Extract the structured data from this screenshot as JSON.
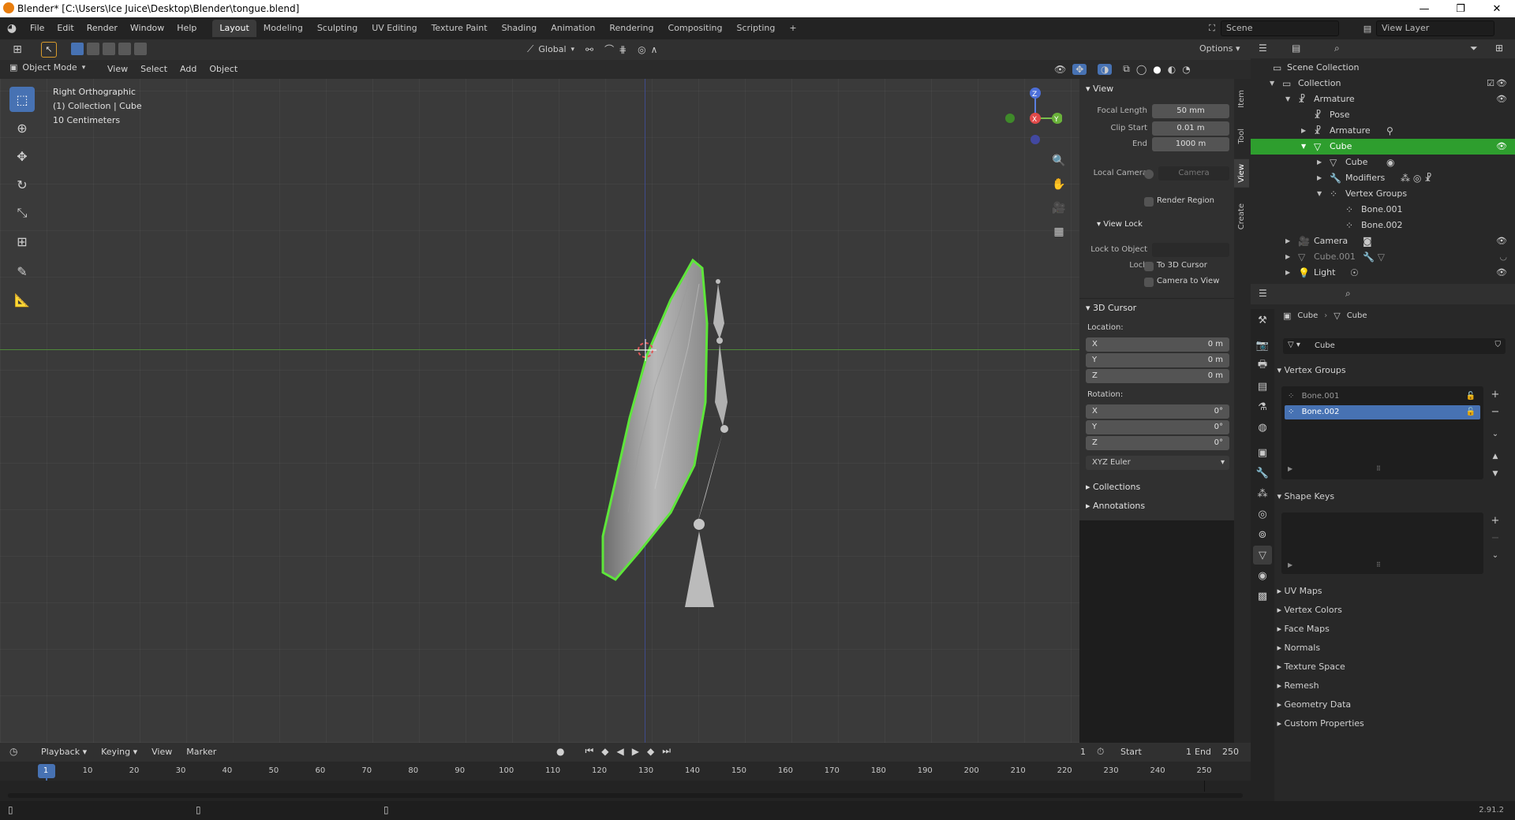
{
  "window": {
    "title": "Blender* [C:\\Users\\Ice Juice\\Desktop\\Blender\\tongue.blend]",
    "minimize": "—",
    "maximize": "❐",
    "close": "✕"
  },
  "menubar": {
    "items": [
      "File",
      "Edit",
      "Render",
      "Window",
      "Help"
    ],
    "workspaces": [
      "Layout",
      "Modeling",
      "Sculpting",
      "UV Editing",
      "Texture Paint",
      "Shading",
      "Animation",
      "Rendering",
      "Compositing",
      "Scripting"
    ],
    "active_workspace": "Layout",
    "add_tab": "+",
    "scene": "Scene",
    "view_layer": "View Layer"
  },
  "viewport_header": {
    "transform_orientation": "Global",
    "options": "Options",
    "mode": "Object Mode",
    "menus": [
      "View",
      "Select",
      "Add",
      "Object"
    ]
  },
  "viewport": {
    "view_name": "Right Orthographic",
    "collection_info": "(1) Collection | Cube",
    "scale": "10 Centimeters",
    "gizmo": {
      "z": "Z",
      "x": "X",
      "y": "Y"
    }
  },
  "npanel": {
    "tabs": [
      "Item",
      "Tool",
      "View",
      "Create"
    ],
    "view": {
      "title": "View",
      "focal_length_label": "Focal Length",
      "focal_length": "50 mm",
      "clip_start_label": "Clip Start",
      "clip_start": "0.01 m",
      "end_label": "End",
      "end": "1000 m",
      "local_camera_label": "Local Camera",
      "local_camera_placeholder": "Camera",
      "render_region": "Render Region"
    },
    "view_lock": {
      "title": "View Lock",
      "lock_to_object_label": "Lock to Object",
      "lock_label": "Lock",
      "to_3d_cursor": "To 3D Cursor",
      "camera_to_view": "Camera to View"
    },
    "cursor": {
      "title": "3D Cursor",
      "location_label": "Location:",
      "loc_x_label": "X",
      "loc_x": "0 m",
      "loc_y_label": "Y",
      "loc_y": "0 m",
      "loc_z_label": "Z",
      "loc_z": "0 m",
      "rotation_label": "Rotation:",
      "rot_x_label": "X",
      "rot_x": "0°",
      "rot_y_label": "Y",
      "rot_y": "0°",
      "rot_z_label": "Z",
      "rot_z": "0°",
      "rotation_mode": "XYZ Euler"
    },
    "collections": "Collections",
    "annotations": "Annotations"
  },
  "outliner": {
    "rows": [
      {
        "label": "Scene Collection",
        "indent": 0
      },
      {
        "label": "Collection",
        "indent": 1
      },
      {
        "label": "Armature",
        "indent": 2
      },
      {
        "label": "Pose",
        "indent": 3
      },
      {
        "label": "Armature",
        "indent": 3
      },
      {
        "label": "Cube",
        "indent": 2
      },
      {
        "label": "Cube",
        "indent": 3
      },
      {
        "label": "Modifiers",
        "indent": 3
      },
      {
        "label": "Vertex Groups",
        "indent": 3
      },
      {
        "label": "Bone.001",
        "indent": 4
      },
      {
        "label": "Bone.002",
        "indent": 4
      },
      {
        "label": "Camera",
        "indent": 2
      },
      {
        "label": "Cube.001",
        "indent": 2
      },
      {
        "label": "Light",
        "indent": 2
      }
    ]
  },
  "properties": {
    "breadcrumb_object": "Cube",
    "breadcrumb_data": "Cube",
    "data_name": "Cube",
    "vertex_groups_title": "Vertex Groups",
    "vertex_groups": [
      "Bone.001",
      "Bone.002"
    ],
    "active_vertex_group": "Bone.002",
    "shape_keys_title": "Shape Keys",
    "collapsed_sections": [
      "UV Maps",
      "Vertex Colors",
      "Face Maps",
      "Normals",
      "Texture Space",
      "Remesh",
      "Geometry Data",
      "Custom Properties"
    ]
  },
  "timeline": {
    "menus": [
      "Playback",
      "Keying",
      "View",
      "Marker"
    ],
    "current_frame": "1",
    "start_label": "Start",
    "start": "1",
    "end_label": "End",
    "end": "250",
    "ticks": [
      "1",
      "10",
      "20",
      "30",
      "40",
      "50",
      "60",
      "70",
      "80",
      "90",
      "100",
      "110",
      "120",
      "130",
      "140",
      "150",
      "160",
      "170",
      "180",
      "190",
      "200",
      "210",
      "220",
      "230",
      "240",
      "250"
    ]
  },
  "status": {
    "version": "2.91.2"
  },
  "colors": {
    "accent": "#4772b3",
    "selection_green": "#2e9e2e",
    "outline_green": "#5ee63a"
  }
}
